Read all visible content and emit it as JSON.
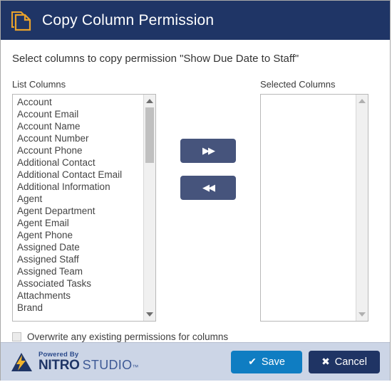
{
  "header": {
    "title": "Copy Column Permission",
    "icon": "copy-documents-icon"
  },
  "body": {
    "instruction": "Select columns to copy permission \"Show Due Date to Staff\"",
    "left_panel": {
      "label": "List Columns",
      "items": [
        "Account",
        "Account Email",
        "Account Name",
        "Account Number",
        "Account Phone",
        "Additional Contact",
        "Additional Contact Email",
        "Additional Information",
        "Agent",
        "Agent Department",
        "Agent Email",
        "Agent Phone",
        "Assigned Date",
        "Assigned Staff",
        "Assigned Team",
        "Associated Tasks",
        "Attachments",
        "Brand"
      ]
    },
    "right_panel": {
      "label": "Selected Columns",
      "items": []
    },
    "transfer": {
      "add_label": "▶▶",
      "remove_label": "◀◀"
    },
    "overwrite": {
      "label": "Overwrite any existing permissions for columns",
      "checked": false
    }
  },
  "footer": {
    "logo": {
      "powered_by": "Powered By",
      "nitro": "NITRO",
      "studio": "STUDIO",
      "tm": "™"
    },
    "save_label": "Save",
    "save_glyph": "✔",
    "cancel_label": "Cancel",
    "cancel_glyph": "✖"
  },
  "colors": {
    "header_bg": "#1f3566",
    "icon_orange": "#e9a22b",
    "footer_bg": "#ccd5e6",
    "save_blue": "#0f7dc2",
    "cancel_navy": "#1f3464",
    "transfer_btn": "#46547c"
  }
}
